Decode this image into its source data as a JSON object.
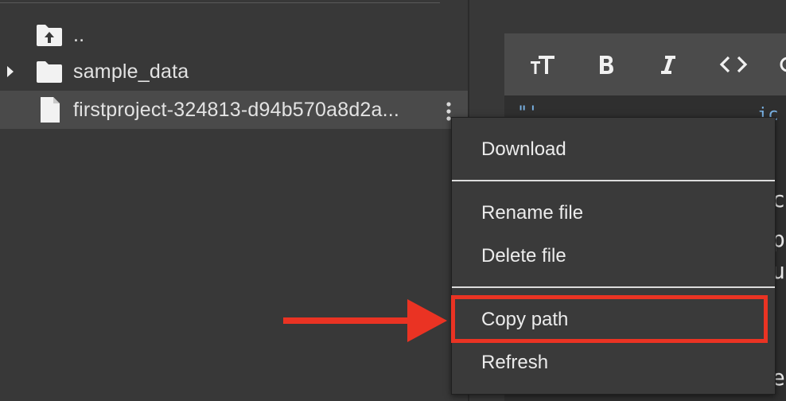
{
  "file_panel": {
    "rows": [
      {
        "label": "..",
        "icon": "folder-up-icon"
      },
      {
        "label": "sample_data",
        "icon": "folder-icon"
      },
      {
        "label": "firstproject-324813-d94b570a8d2a...",
        "icon": "file-icon"
      }
    ]
  },
  "toolbar": {
    "items": [
      {
        "icon": "text-size-icon",
        "label": "TT"
      },
      {
        "icon": "bold-icon",
        "label": "B"
      },
      {
        "icon": "italic-icon",
        "label": "I"
      },
      {
        "icon": "code-icon",
        "label": "<>"
      }
    ]
  },
  "context_menu": {
    "items": [
      {
        "label": "Download"
      },
      {
        "label": "Rename file"
      },
      {
        "label": "Delete file"
      },
      {
        "label": "Copy path"
      },
      {
        "label": "Refresh"
      }
    ]
  },
  "colors": {
    "highlight": "#ea3323",
    "background": "#383838",
    "menu_bg": "#3a3a3a",
    "selected_row": "#4a4a4a"
  }
}
